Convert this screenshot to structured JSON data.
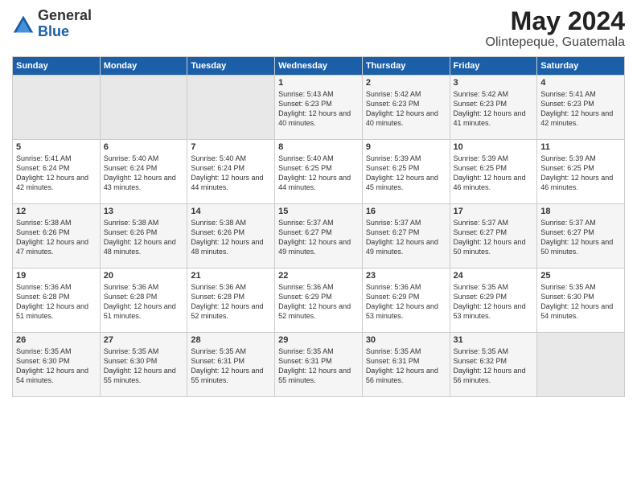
{
  "logo": {
    "general": "General",
    "blue": "Blue"
  },
  "header": {
    "month": "May 2024",
    "location": "Olintepeque, Guatemala"
  },
  "days_of_week": [
    "Sunday",
    "Monday",
    "Tuesday",
    "Wednesday",
    "Thursday",
    "Friday",
    "Saturday"
  ],
  "weeks": [
    [
      {
        "num": "",
        "sunrise": "",
        "sunset": "",
        "daylight": "",
        "empty": true
      },
      {
        "num": "",
        "sunrise": "",
        "sunset": "",
        "daylight": "",
        "empty": true
      },
      {
        "num": "",
        "sunrise": "",
        "sunset": "",
        "daylight": "",
        "empty": true
      },
      {
        "num": "1",
        "sunrise": "Sunrise: 5:43 AM",
        "sunset": "Sunset: 6:23 PM",
        "daylight": "Daylight: 12 hours and 40 minutes."
      },
      {
        "num": "2",
        "sunrise": "Sunrise: 5:42 AM",
        "sunset": "Sunset: 6:23 PM",
        "daylight": "Daylight: 12 hours and 40 minutes."
      },
      {
        "num": "3",
        "sunrise": "Sunrise: 5:42 AM",
        "sunset": "Sunset: 6:23 PM",
        "daylight": "Daylight: 12 hours and 41 minutes."
      },
      {
        "num": "4",
        "sunrise": "Sunrise: 5:41 AM",
        "sunset": "Sunset: 6:23 PM",
        "daylight": "Daylight: 12 hours and 42 minutes."
      }
    ],
    [
      {
        "num": "5",
        "sunrise": "Sunrise: 5:41 AM",
        "sunset": "Sunset: 6:24 PM",
        "daylight": "Daylight: 12 hours and 42 minutes."
      },
      {
        "num": "6",
        "sunrise": "Sunrise: 5:40 AM",
        "sunset": "Sunset: 6:24 PM",
        "daylight": "Daylight: 12 hours and 43 minutes."
      },
      {
        "num": "7",
        "sunrise": "Sunrise: 5:40 AM",
        "sunset": "Sunset: 6:24 PM",
        "daylight": "Daylight: 12 hours and 44 minutes."
      },
      {
        "num": "8",
        "sunrise": "Sunrise: 5:40 AM",
        "sunset": "Sunset: 6:25 PM",
        "daylight": "Daylight: 12 hours and 44 minutes."
      },
      {
        "num": "9",
        "sunrise": "Sunrise: 5:39 AM",
        "sunset": "Sunset: 6:25 PM",
        "daylight": "Daylight: 12 hours and 45 minutes."
      },
      {
        "num": "10",
        "sunrise": "Sunrise: 5:39 AM",
        "sunset": "Sunset: 6:25 PM",
        "daylight": "Daylight: 12 hours and 46 minutes."
      },
      {
        "num": "11",
        "sunrise": "Sunrise: 5:39 AM",
        "sunset": "Sunset: 6:25 PM",
        "daylight": "Daylight: 12 hours and 46 minutes."
      }
    ],
    [
      {
        "num": "12",
        "sunrise": "Sunrise: 5:38 AM",
        "sunset": "Sunset: 6:26 PM",
        "daylight": "Daylight: 12 hours and 47 minutes."
      },
      {
        "num": "13",
        "sunrise": "Sunrise: 5:38 AM",
        "sunset": "Sunset: 6:26 PM",
        "daylight": "Daylight: 12 hours and 48 minutes."
      },
      {
        "num": "14",
        "sunrise": "Sunrise: 5:38 AM",
        "sunset": "Sunset: 6:26 PM",
        "daylight": "Daylight: 12 hours and 48 minutes."
      },
      {
        "num": "15",
        "sunrise": "Sunrise: 5:37 AM",
        "sunset": "Sunset: 6:27 PM",
        "daylight": "Daylight: 12 hours and 49 minutes."
      },
      {
        "num": "16",
        "sunrise": "Sunrise: 5:37 AM",
        "sunset": "Sunset: 6:27 PM",
        "daylight": "Daylight: 12 hours and 49 minutes."
      },
      {
        "num": "17",
        "sunrise": "Sunrise: 5:37 AM",
        "sunset": "Sunset: 6:27 PM",
        "daylight": "Daylight: 12 hours and 50 minutes."
      },
      {
        "num": "18",
        "sunrise": "Sunrise: 5:37 AM",
        "sunset": "Sunset: 6:27 PM",
        "daylight": "Daylight: 12 hours and 50 minutes."
      }
    ],
    [
      {
        "num": "19",
        "sunrise": "Sunrise: 5:36 AM",
        "sunset": "Sunset: 6:28 PM",
        "daylight": "Daylight: 12 hours and 51 minutes."
      },
      {
        "num": "20",
        "sunrise": "Sunrise: 5:36 AM",
        "sunset": "Sunset: 6:28 PM",
        "daylight": "Daylight: 12 hours and 51 minutes."
      },
      {
        "num": "21",
        "sunrise": "Sunrise: 5:36 AM",
        "sunset": "Sunset: 6:28 PM",
        "daylight": "Daylight: 12 hours and 52 minutes."
      },
      {
        "num": "22",
        "sunrise": "Sunrise: 5:36 AM",
        "sunset": "Sunset: 6:29 PM",
        "daylight": "Daylight: 12 hours and 52 minutes."
      },
      {
        "num": "23",
        "sunrise": "Sunrise: 5:36 AM",
        "sunset": "Sunset: 6:29 PM",
        "daylight": "Daylight: 12 hours and 53 minutes."
      },
      {
        "num": "24",
        "sunrise": "Sunrise: 5:35 AM",
        "sunset": "Sunset: 6:29 PM",
        "daylight": "Daylight: 12 hours and 53 minutes."
      },
      {
        "num": "25",
        "sunrise": "Sunrise: 5:35 AM",
        "sunset": "Sunset: 6:30 PM",
        "daylight": "Daylight: 12 hours and 54 minutes."
      }
    ],
    [
      {
        "num": "26",
        "sunrise": "Sunrise: 5:35 AM",
        "sunset": "Sunset: 6:30 PM",
        "daylight": "Daylight: 12 hours and 54 minutes."
      },
      {
        "num": "27",
        "sunrise": "Sunrise: 5:35 AM",
        "sunset": "Sunset: 6:30 PM",
        "daylight": "Daylight: 12 hours and 55 minutes."
      },
      {
        "num": "28",
        "sunrise": "Sunrise: 5:35 AM",
        "sunset": "Sunset: 6:31 PM",
        "daylight": "Daylight: 12 hours and 55 minutes."
      },
      {
        "num": "29",
        "sunrise": "Sunrise: 5:35 AM",
        "sunset": "Sunset: 6:31 PM",
        "daylight": "Daylight: 12 hours and 55 minutes."
      },
      {
        "num": "30",
        "sunrise": "Sunrise: 5:35 AM",
        "sunset": "Sunset: 6:31 PM",
        "daylight": "Daylight: 12 hours and 56 minutes."
      },
      {
        "num": "31",
        "sunrise": "Sunrise: 5:35 AM",
        "sunset": "Sunset: 6:32 PM",
        "daylight": "Daylight: 12 hours and 56 minutes."
      },
      {
        "num": "",
        "sunrise": "",
        "sunset": "",
        "daylight": "",
        "empty": true
      }
    ]
  ]
}
